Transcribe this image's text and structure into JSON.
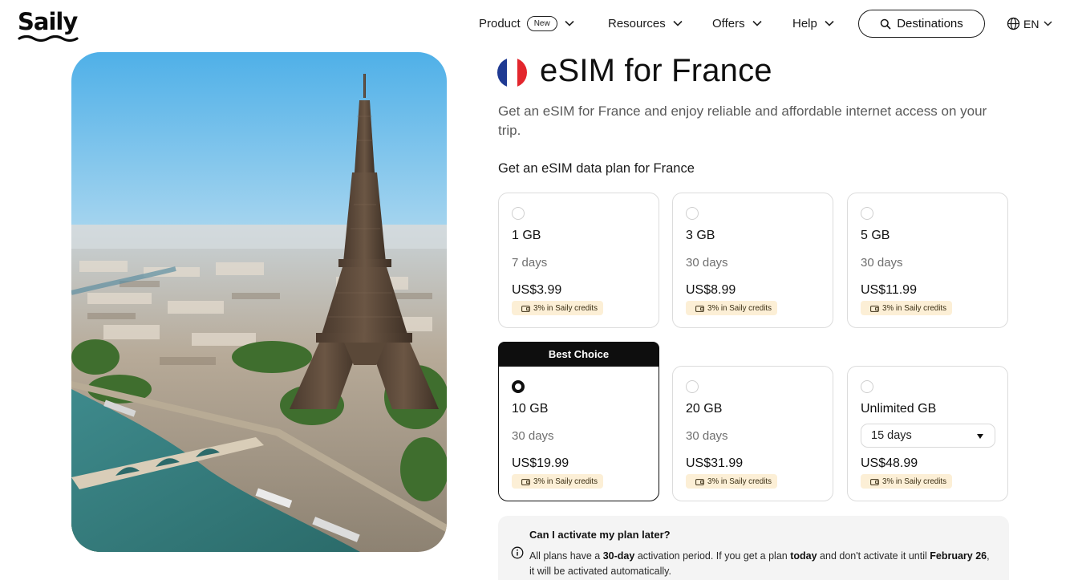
{
  "brand": {
    "name": "Saily"
  },
  "nav": {
    "product": "Product",
    "product_badge": "New",
    "resources": "Resources",
    "offers": "Offers",
    "help": "Help",
    "destinations": "Destinations",
    "language": "EN"
  },
  "hero": {
    "icon": "eiffel-tower-photo"
  },
  "page": {
    "title": "eSIM for France",
    "subtitle": "Get an eSIM for France and enjoy reliable and affordable internet access on your trip.",
    "section_title": "Get an eSIM data plan for France"
  },
  "flag": {
    "colors": [
      "#1f3a93",
      "#ffffff",
      "#e3262d"
    ]
  },
  "plans": [
    {
      "data": "1 GB",
      "days": "7 days",
      "price": "US$3.99",
      "credits": "3% in Saily credits",
      "selected": false
    },
    {
      "data": "3 GB",
      "days": "30 days",
      "price": "US$8.99",
      "credits": "3% in Saily credits",
      "selected": false
    },
    {
      "data": "5 GB",
      "days": "30 days",
      "price": "US$11.99",
      "credits": "3% in Saily credits",
      "selected": false
    },
    {
      "data": "10 GB",
      "days": "30 days",
      "price": "US$19.99",
      "credits": "3% in Saily credits",
      "selected": true,
      "badge": "Best Choice"
    },
    {
      "data": "20 GB",
      "days": "30 days",
      "price": "US$31.99",
      "credits": "3% in Saily credits",
      "selected": false
    },
    {
      "data": "Unlimited GB",
      "days": "15 days",
      "price": "US$48.99",
      "credits": "3% in Saily credits",
      "selected": false
    }
  ],
  "faq": {
    "question": "Can I activate my plan later?",
    "answer_parts": [
      "All plans have a ",
      "30-day",
      " activation period. If you get a plan ",
      "today",
      " and don't activate it until ",
      "February 26",
      ", it will be activated automatically."
    ]
  },
  "colors": {
    "accent": "#0e0e0e",
    "credits_bg": "#fcefd6",
    "faq_bg": "#f4f4f4"
  }
}
